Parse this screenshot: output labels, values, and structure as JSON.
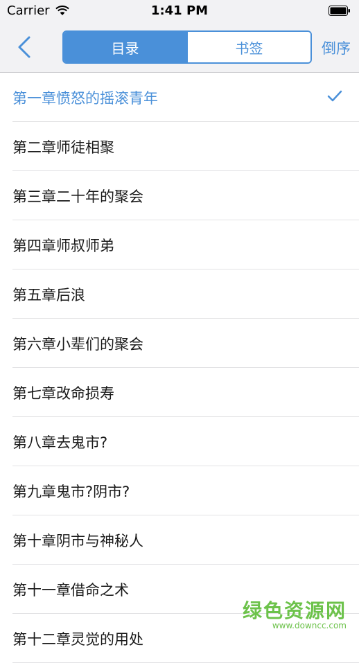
{
  "status_bar": {
    "carrier": "Carrier",
    "time": "1:41 PM"
  },
  "nav": {
    "back_icon": "chevron-left-icon",
    "segments": [
      {
        "label": "目录",
        "active": true
      },
      {
        "label": "书签",
        "active": false
      }
    ],
    "order_label": "倒序"
  },
  "chapters": [
    {
      "title": "第一章愤怒的摇滚青年",
      "current": true
    },
    {
      "title": "第二章师徒相聚",
      "current": false
    },
    {
      "title": "第三章二十年的聚会",
      "current": false
    },
    {
      "title": "第四章师叔师弟",
      "current": false
    },
    {
      "title": "第五章后浪",
      "current": false
    },
    {
      "title": "第六章小辈们的聚会",
      "current": false
    },
    {
      "title": "第七章改命损寿",
      "current": false
    },
    {
      "title": "第八章去鬼市?",
      "current": false
    },
    {
      "title": "第九章鬼市?阴市?",
      "current": false
    },
    {
      "title": "第十章阴市与神秘人",
      "current": false
    },
    {
      "title": "第十一章借命之术",
      "current": false
    },
    {
      "title": "第十二章灵觉的用处",
      "current": false
    }
  ],
  "watermark": {
    "title": "绿色资源网",
    "url": "www.downcc.com"
  },
  "colors": {
    "accent": "#4a90d9",
    "watermark": "#6cc24a"
  }
}
